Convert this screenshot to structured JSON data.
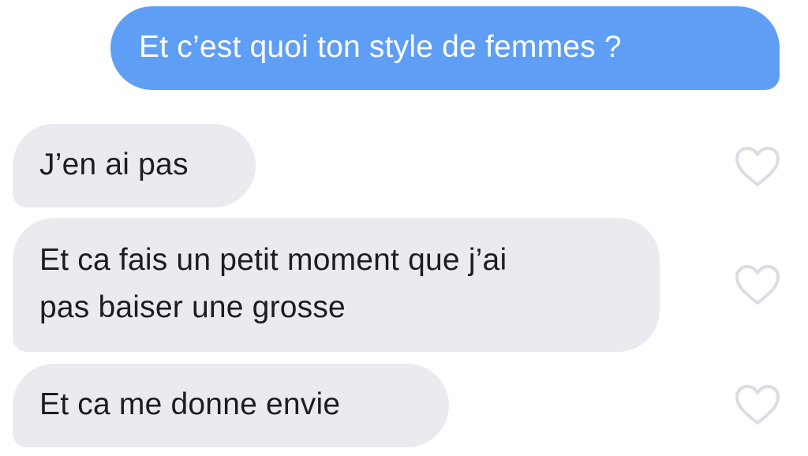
{
  "conversation": {
    "sent_messages": [
      {
        "text": "Et c’est quoi ton style de femmes ?"
      }
    ],
    "received_messages": [
      {
        "lines": [
          "J’en ai pas"
        ]
      },
      {
        "lines": [
          "Et ca fais un petit moment que j’ai",
          "pas baiser une grosse"
        ]
      },
      {
        "lines": [
          "Et ca me donne envie"
        ]
      }
    ],
    "like_icon": "heart-outline-icon"
  },
  "colors": {
    "sent_bubble": "#5f9ef5",
    "received_bubble": "#ebebef",
    "sent_text": "#ffffff",
    "received_text": "#1d1d21",
    "heart_stroke": "#dcdce6"
  }
}
